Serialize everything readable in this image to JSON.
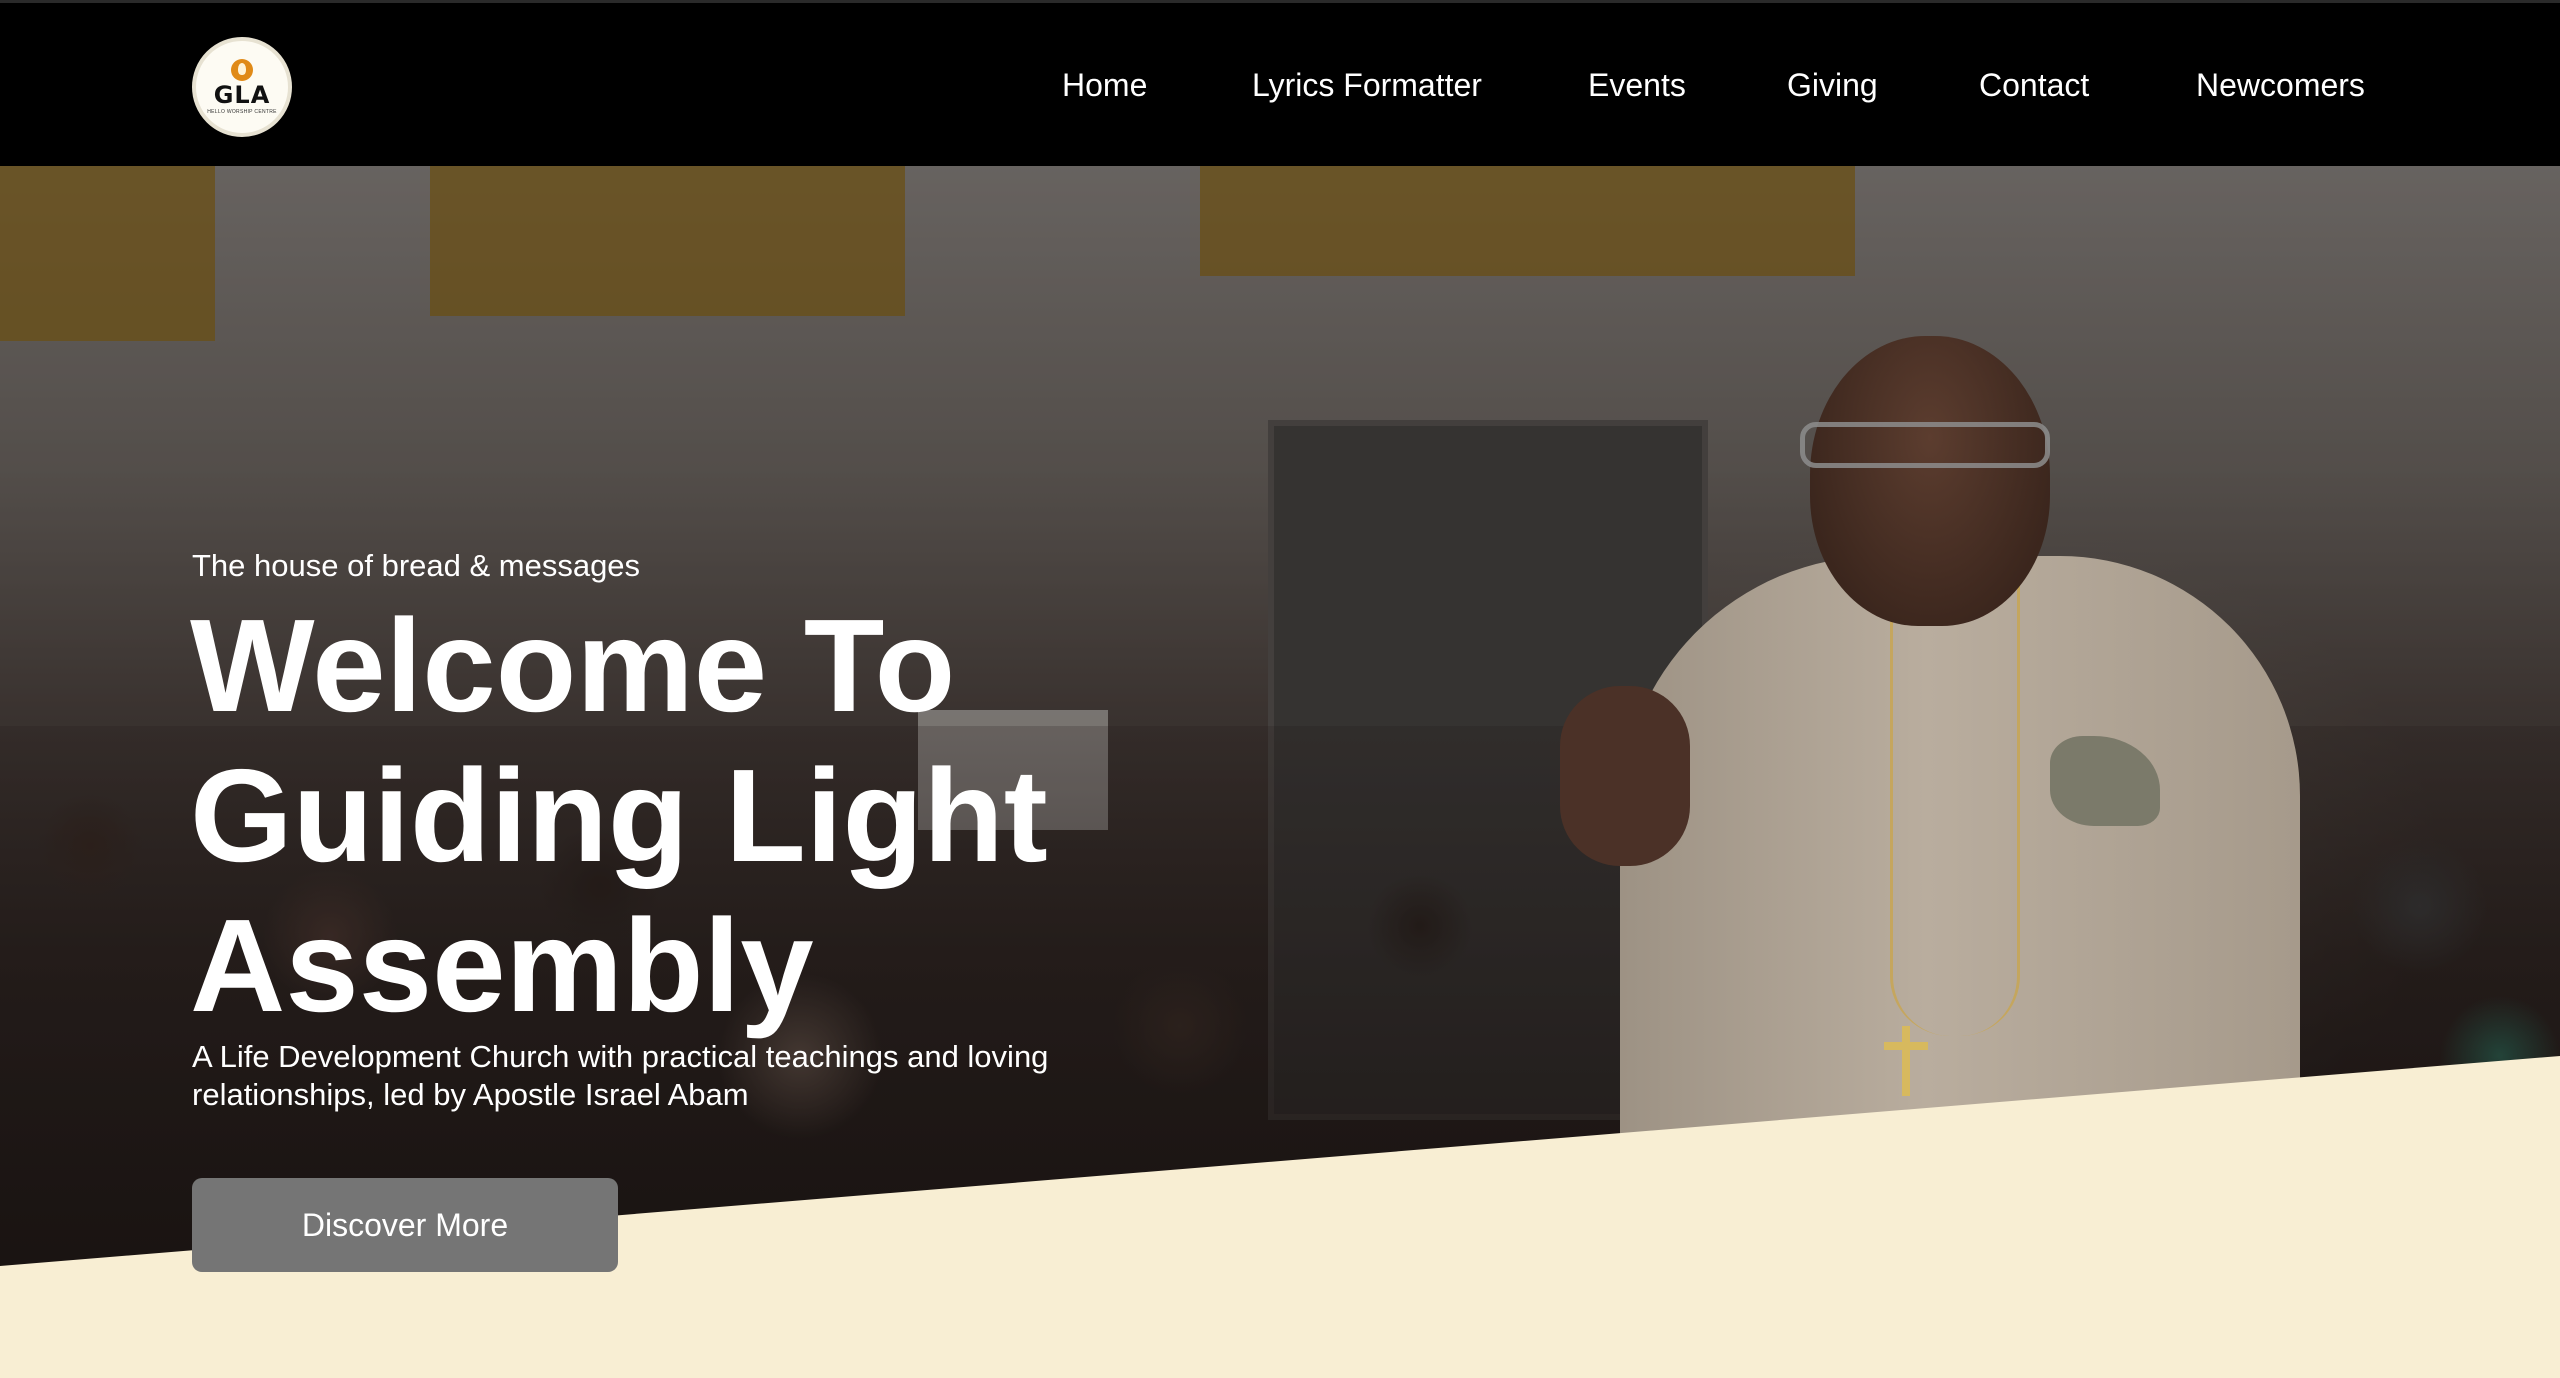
{
  "header": {
    "logo": {
      "text": "GLA",
      "subtext": "HELLO WORSHIP CENTRE"
    },
    "nav": [
      {
        "label": "Home"
      },
      {
        "label": "Lyrics Formatter"
      },
      {
        "label": "Events"
      },
      {
        "label": "Giving"
      },
      {
        "label": "Contact"
      },
      {
        "label": "Newcomers"
      }
    ]
  },
  "hero": {
    "tagline": "The house of bread & messages",
    "title": "Welcome To Guiding Light Assembly",
    "subtitle": "A Life Development Church with practical teachings and loving relationships, led by Apostle Israel Abam",
    "cta_label": "Discover More",
    "image_desc_icon": "speaker-photo"
  },
  "colors": {
    "nav_bg": "#000000",
    "cream": "#f8eed3",
    "cta_bg": "#757575",
    "text": "#ffffff"
  }
}
